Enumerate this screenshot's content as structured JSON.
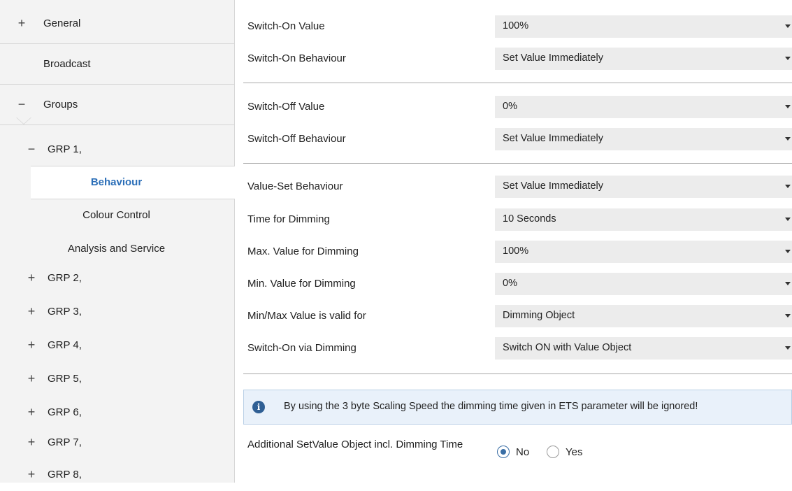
{
  "sidebar": {
    "general": {
      "symbol": "+",
      "label": "General"
    },
    "broadcast": {
      "label": "Broadcast"
    },
    "groups": {
      "symbol": "−",
      "label": "Groups"
    },
    "grp1": {
      "symbol": "−",
      "label": "GRP 1,"
    },
    "sub_items": [
      {
        "label": "Behaviour",
        "active": true
      },
      {
        "label": "Colour Control"
      },
      {
        "label": "Analysis and Service"
      }
    ],
    "collapsed_groups": [
      {
        "symbol": "+",
        "label": "GRP 2,"
      },
      {
        "symbol": "+",
        "label": "GRP 3,"
      },
      {
        "symbol": "+",
        "label": "GRP 4,"
      },
      {
        "symbol": "+",
        "label": "GRP 5,"
      },
      {
        "symbol": "+",
        "label": "GRP 6,"
      },
      {
        "symbol": "+",
        "label": "GRP 7,"
      },
      {
        "symbol": "+",
        "label": "GRP 8,"
      }
    ]
  },
  "params": [
    {
      "label": "Switch-On Value",
      "value": "100%"
    },
    {
      "label": "Switch-On Behaviour",
      "value": "Set Value Immediately"
    },
    {
      "label": "Switch-Off Value",
      "value": "0%"
    },
    {
      "label": "Switch-Off Behaviour",
      "value": "Set Value Immediately"
    },
    {
      "label": "Value-Set Behaviour",
      "value": "Set Value Immediately"
    },
    {
      "label": "Time for Dimming",
      "value": "10 Seconds"
    },
    {
      "label": "Max. Value for Dimming",
      "value": "100%"
    },
    {
      "label": "Min. Value for Dimming",
      "value": "0%"
    },
    {
      "label": "Min/Max Value is valid for",
      "value": "Dimming Object"
    },
    {
      "label": "Switch-On via Dimming",
      "value": "Switch ON with Value Object"
    }
  ],
  "info": {
    "icon": "info-icon",
    "text": "By using the 3 byte Scaling Speed the dimming time given in ETS parameter will be ignored!"
  },
  "additional_setvalue": {
    "label": "Additional SetValue Object incl. Dimming Time",
    "options": [
      {
        "label": "No",
        "checked": true
      },
      {
        "label": "Yes",
        "checked": false
      }
    ]
  },
  "colors": {
    "active_nav": "#2c6fb8",
    "radio_selected": "#3a6ea5",
    "info_icon": "#2f5f94"
  }
}
